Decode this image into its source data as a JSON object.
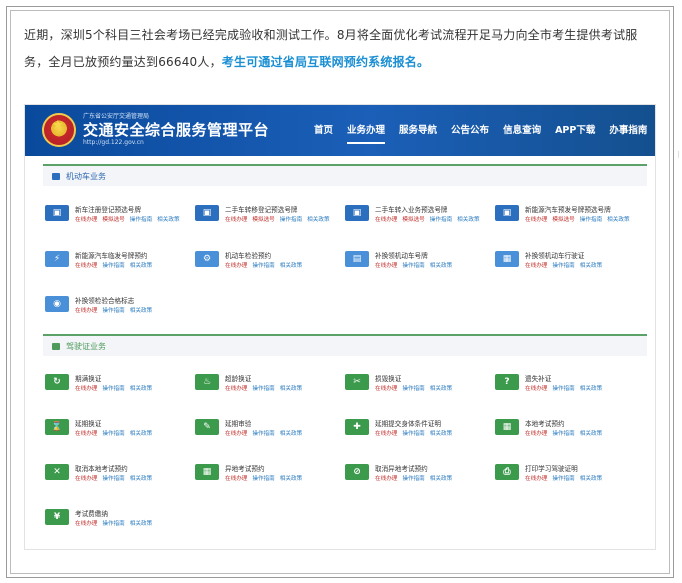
{
  "article": {
    "text": "近期，深圳5个科目三社会考场已经完成验收和测试工作。8月将全面优化考试流程开足马力向全市考生提供考试服务，全月已放预约量达到66640人，",
    "link": "考生可通过省局互联网预约系统报名。"
  },
  "site": {
    "subtitle": "广东省公安厅交通管理局",
    "title": "交通安全综合服务管理平台",
    "url": "http://gd.122.gov.cn"
  },
  "nav": [
    "首页",
    "业务办理",
    "服务导航",
    "公告公布",
    "信息查询",
    "APP下载",
    "办事指南"
  ],
  "links": {
    "a": "在线办理",
    "b": "操作指南",
    "c": "相关政策"
  },
  "links_alt": {
    "a": "在线办理",
    "b": "模拟选号",
    "c": "操作指南",
    "d": "相关政策"
  },
  "vehicle": {
    "heading": "机动车业务",
    "items": [
      {
        "title": "新车注册登记预选号牌",
        "icon": "plate-icon",
        "alt": true
      },
      {
        "title": "二手车转移登记预选号牌",
        "icon": "plate-icon",
        "alt": true
      },
      {
        "title": "二手车转入业务预选号牌",
        "icon": "plate-icon",
        "alt": false
      },
      {
        "title": "新能源汽车预发号牌预选号牌",
        "icon": "plate-icon",
        "alt": false
      },
      {
        "title": "新能源汽车临发号牌预约",
        "icon": "ev-car-icon",
        "alt": false
      },
      {
        "title": "机动车检验预约",
        "icon": "inspection-icon",
        "alt": false
      },
      {
        "title": "补换领机动车号牌",
        "icon": "replace-plate-icon",
        "alt": false
      },
      {
        "title": "补换领机动车行驶证",
        "icon": "license-card-icon",
        "alt": false
      },
      {
        "title": "补换领检验合格标志",
        "icon": "eye-badge-icon",
        "alt": false
      }
    ]
  },
  "driver": {
    "heading": "驾驶证业务",
    "items": [
      {
        "title": "期满换证",
        "icon": "renew-icon"
      },
      {
        "title": "超龄换证",
        "icon": "age-icon"
      },
      {
        "title": "损毁换证",
        "icon": "damaged-icon"
      },
      {
        "title": "遗失补证",
        "icon": "lost-icon"
      },
      {
        "title": "延期换证",
        "icon": "delay-icon"
      },
      {
        "title": "延期审验",
        "icon": "delay-review-icon"
      },
      {
        "title": "延期提交身体条件证明",
        "icon": "health-icon"
      },
      {
        "title": "本地考试预约",
        "icon": "calendar-icon"
      },
      {
        "title": "取消本地考试预约",
        "icon": "cancel-icon"
      },
      {
        "title": "异地考试预约",
        "icon": "remote-calendar-icon"
      },
      {
        "title": "取消异地考试预约",
        "icon": "remote-cancel-icon"
      },
      {
        "title": "打印学习驾驶证明",
        "icon": "printer-icon"
      },
      {
        "title": "考试费缴纳",
        "icon": "fee-icon"
      }
    ]
  }
}
